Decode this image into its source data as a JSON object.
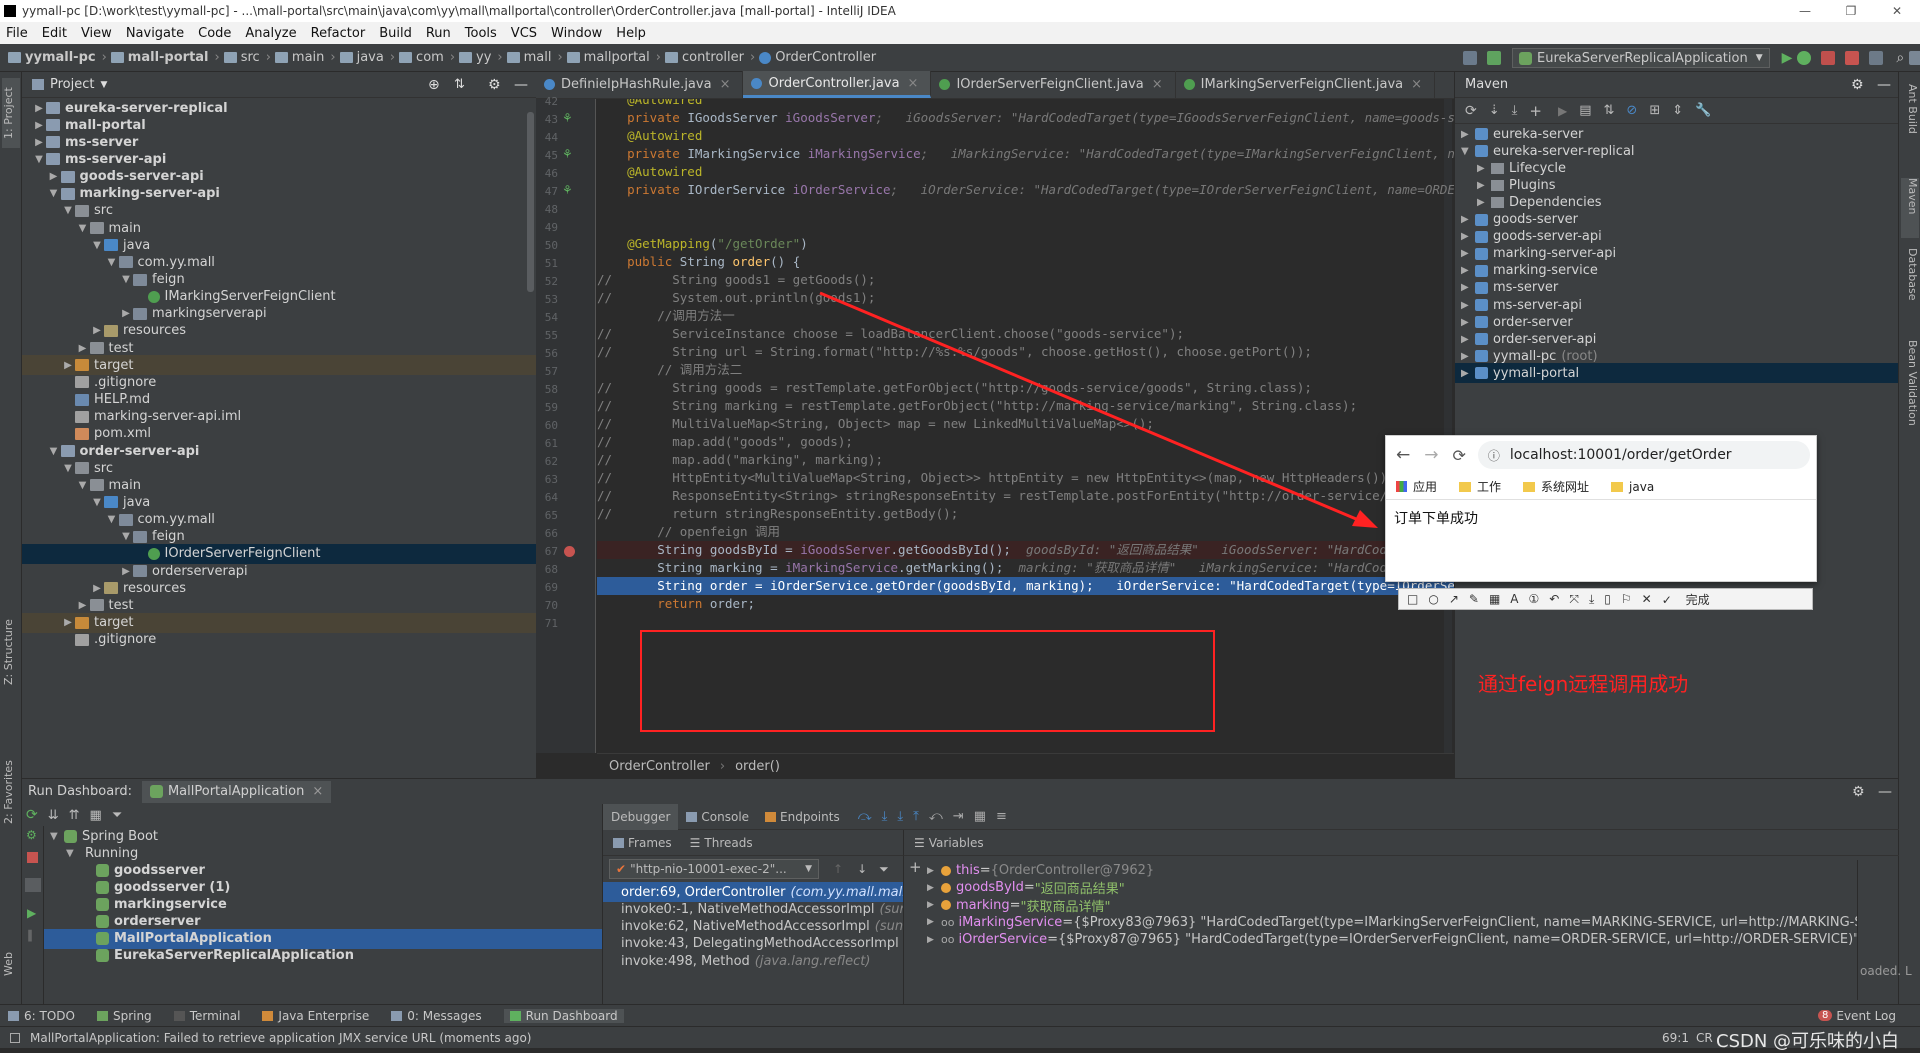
{
  "window": {
    "title": "yymall-pc [D:\\work\\test\\yymall-pc] - ...\\mall-portal\\src\\main\\java\\com\\yy\\mall\\mallportal\\controller\\OrderController.java [mall-portal] - IntelliJ IDEA"
  },
  "menu": [
    "File",
    "Edit",
    "View",
    "Navigate",
    "Code",
    "Analyze",
    "Refactor",
    "Build",
    "Run",
    "Tools",
    "VCS",
    "Window",
    "Help"
  ],
  "nav": {
    "crumbs": [
      "yymall-pc",
      "mall-portal",
      "src",
      "main",
      "java",
      "com",
      "yy",
      "mall",
      "mallportal",
      "controller",
      "OrderController"
    ],
    "run_config": "EurekaServerReplicalApplication"
  },
  "left_strip": {
    "project": "1: Project",
    "structure": "Z: Structure",
    "favorites": "2: Favorites",
    "web": "Web"
  },
  "project": {
    "header": "Project",
    "rows": [
      {
        "label": "eureka-server-replical",
        "depth": 0,
        "arrow": "▶",
        "icon": "mod",
        "bold": true
      },
      {
        "label": "mall-portal",
        "depth": 0,
        "arrow": "▶",
        "icon": "mod",
        "bold": true
      },
      {
        "label": "ms-server",
        "depth": 0,
        "arrow": "▶",
        "icon": "mod",
        "bold": true
      },
      {
        "label": "ms-server-api",
        "depth": 0,
        "arrow": "▼",
        "icon": "mod",
        "bold": true
      },
      {
        "label": "goods-server-api",
        "depth": 1,
        "arrow": "▶",
        "icon": "mod",
        "bold": true
      },
      {
        "label": "marking-server-api",
        "depth": 1,
        "arrow": "▼",
        "icon": "mod",
        "bold": true
      },
      {
        "label": "src",
        "depth": 2,
        "arrow": "▼",
        "icon": "fold"
      },
      {
        "label": "main",
        "depth": 3,
        "arrow": "▼",
        "icon": "fold"
      },
      {
        "label": "java",
        "depth": 4,
        "arrow": "▼",
        "icon": "src"
      },
      {
        "label": "com.yy.mall",
        "depth": 5,
        "arrow": "▼",
        "icon": "pkg"
      },
      {
        "label": "feign",
        "depth": 6,
        "arrow": "▼",
        "icon": "pkg"
      },
      {
        "label": "IMarkingServerFeignClient",
        "depth": 7,
        "arrow": "",
        "icon": "iface"
      },
      {
        "label": "markingserverapi",
        "depth": 6,
        "arrow": "▶",
        "icon": "pkg"
      },
      {
        "label": "resources",
        "depth": 4,
        "arrow": "▶",
        "icon": "res"
      },
      {
        "label": "test",
        "depth": 3,
        "arrow": "▶",
        "icon": "fold"
      },
      {
        "label": "target",
        "depth": 2,
        "arrow": "▶",
        "icon": "excl",
        "hl": true
      },
      {
        "label": ".gitignore",
        "depth": 2,
        "arrow": "",
        "icon": "file"
      },
      {
        "label": "HELP.md",
        "depth": 2,
        "arrow": "",
        "icon": "md"
      },
      {
        "label": "marking-server-api.iml",
        "depth": 2,
        "arrow": "",
        "icon": "file"
      },
      {
        "label": "pom.xml",
        "depth": 2,
        "arrow": "",
        "icon": "xml"
      },
      {
        "label": "order-server-api",
        "depth": 1,
        "arrow": "▼",
        "icon": "mod",
        "bold": true
      },
      {
        "label": "src",
        "depth": 2,
        "arrow": "▼",
        "icon": "fold"
      },
      {
        "label": "main",
        "depth": 3,
        "arrow": "▼",
        "icon": "fold"
      },
      {
        "label": "java",
        "depth": 4,
        "arrow": "▼",
        "icon": "src"
      },
      {
        "label": "com.yy.mall",
        "depth": 5,
        "arrow": "▼",
        "icon": "pkg"
      },
      {
        "label": "feign",
        "depth": 6,
        "arrow": "▼",
        "icon": "pkg"
      },
      {
        "label": "IOrderServerFeignClient",
        "depth": 7,
        "arrow": "",
        "icon": "iface",
        "selected": true
      },
      {
        "label": "orderserverapi",
        "depth": 6,
        "arrow": "▶",
        "icon": "pkg"
      },
      {
        "label": "resources",
        "depth": 4,
        "arrow": "▶",
        "icon": "res"
      },
      {
        "label": "test",
        "depth": 3,
        "arrow": "▶",
        "icon": "fold"
      },
      {
        "label": "target",
        "depth": 2,
        "arrow": "▶",
        "icon": "excl",
        "hl": true
      },
      {
        "label": ".gitignore",
        "depth": 2,
        "arrow": "",
        "icon": "file"
      }
    ]
  },
  "editor": {
    "tabs": [
      {
        "label": "DefinieIpHashRule.java",
        "active": false,
        "color": "#4a88c7"
      },
      {
        "label": "OrderController.java",
        "active": true,
        "color": "#4a88c7"
      },
      {
        "label": "IOrderServerFeignClient.java",
        "active": false,
        "color": "#4f9e50"
      },
      {
        "label": "IMarkingServerFeignClient.java",
        "active": false,
        "color": "#4f9e50"
      }
    ],
    "line_numbers": [
      "42",
      "43",
      "44",
      "45",
      "46",
      "47",
      "48",
      "49",
      "50",
      "51",
      "52",
      "53",
      "54",
      "55",
      "56",
      "57",
      "58",
      "59",
      "60",
      "61",
      "62",
      "63",
      "64",
      "65",
      "66",
      "67",
      "68",
      "69",
      "70",
      "71"
    ],
    "breadcrumb": [
      "OrderController",
      "order()"
    ]
  },
  "code_lines": [
    [
      {
        "t": "    @Autowired",
        "c": "an"
      }
    ],
    [
      {
        "t": "    private ",
        "c": "kw"
      },
      {
        "t": "IGoodsServer ",
        "c": ""
      },
      {
        "t": "iGoodsServer",
        "c": "fld"
      },
      {
        "t": ";   iGoodsServer: \"HardCodedTarget(type=IGoodsServerFeignClient, name=goods-service, url=",
        "c": "hint"
      }
    ],
    [
      {
        "t": "    @Autowired",
        "c": "an"
      }
    ],
    [
      {
        "t": "    private ",
        "c": "kw"
      },
      {
        "t": "IMarkingService ",
        "c": ""
      },
      {
        "t": "iMarkingService",
        "c": "fld"
      },
      {
        "t": ";   iMarkingService: \"HardCodedTarget(type=IMarkingServerFeignClient, name=MARK",
        "c": "hint"
      }
    ],
    [
      {
        "t": "    @Autowired",
        "c": "an"
      }
    ],
    [
      {
        "t": "    private ",
        "c": "kw"
      },
      {
        "t": "IOrderService ",
        "c": ""
      },
      {
        "t": "iOrderService",
        "c": "fld"
      },
      {
        "t": ";   iOrderService: \"HardCodedTarget(type=IOrderServerFeignClient, name=ORDER-SERVI",
        "c": "hint"
      }
    ],
    [
      {
        "t": "",
        "c": ""
      }
    ],
    [
      {
        "t": "",
        "c": ""
      }
    ],
    [
      {
        "t": "    @GetMapping",
        "c": "an"
      },
      {
        "t": "(",
        "c": ""
      },
      {
        "t": "\"/getOrder\"",
        "c": "str"
      },
      {
        "t": ")",
        "c": ""
      }
    ],
    [
      {
        "t": "    public ",
        "c": "kw"
      },
      {
        "t": "String ",
        "c": ""
      },
      {
        "t": "order",
        "c": "fn"
      },
      {
        "t": "() {",
        "c": ""
      }
    ],
    [
      {
        "t": "//        String goods1 = getGoods();",
        "c": "cm"
      }
    ],
    [
      {
        "t": "//        System.out.println(goods1);",
        "c": "cm"
      }
    ],
    [
      {
        "t": "        //调用方法一",
        "c": "cm"
      }
    ],
    [
      {
        "t": "//        ServiceInstance choose = loadBalancerClient.choose(\"goods-service\");",
        "c": "cm"
      }
    ],
    [
      {
        "t": "//        String url = String.format(\"http://%s:%s/goods\", choose.getHost(), choose.getPort());",
        "c": "cm"
      }
    ],
    [
      {
        "t": "        // 调用方法二",
        "c": "cm"
      }
    ],
    [
      {
        "t": "//        String goods = restTemplate.getForObject(\"http://goods-service/goods\", String.class);",
        "c": "cm"
      }
    ],
    [
      {
        "t": "//        String marking = restTemplate.getForObject(\"http://marking-service/marking\", String.class);",
        "c": "cm"
      }
    ],
    [
      {
        "t": "//        MultiValueMap<String, Object> map = new LinkedMultiValueMap<>();",
        "c": "cm"
      }
    ],
    [
      {
        "t": "//        map.add(\"goods\", goods);",
        "c": "cm"
      }
    ],
    [
      {
        "t": "//        map.add(\"marking\", marking);",
        "c": "cm"
      }
    ],
    [
      {
        "t": "//        HttpEntity<MultiValueMap<String, Object>> httpEntity = new HttpEntity<>(map, new HttpHeaders());",
        "c": "cm"
      }
    ],
    [
      {
        "t": "//        ResponseEntity<String> stringResponseEntity = restTemplate.postForEntity(\"http://order-service/order\", httpEnti",
        "c": "cm"
      }
    ],
    [
      {
        "t": "//        return stringResponseEntity.getBody();",
        "c": "cm"
      }
    ],
    [
      {
        "t": "        // openfeign 调用",
        "c": "cm"
      }
    ],
    [
      {
        "t": "        String goodsById = ",
        "c": ""
      },
      {
        "t": "iGoodsServer",
        "c": "fld"
      },
      {
        "t": ".getGoodsById();  ",
        "c": ""
      },
      {
        "t": "goodsById: \"返回商品结果\"   iGoodsServer: \"HardCodedTarget(type=I",
        "c": "hint"
      }
    ],
    [
      {
        "t": "        String marking = ",
        "c": ""
      },
      {
        "t": "iMarkingService",
        "c": "fld"
      },
      {
        "t": ".getMarking();  ",
        "c": ""
      },
      {
        "t": "marking: \"获取商品详情\"   iMarkingService: \"HardCodedTarget(type=I",
        "c": "hint"
      }
    ],
    [
      {
        "t": "        String order = iOrderService.getOrder(goodsById, marking);   iOrderService: \"HardCodedTarget(type=IOrderServerFeig",
        "c": ""
      }
    ],
    [
      {
        "t": "        return ",
        "c": "kw"
      },
      {
        "t": "order;",
        "c": ""
      }
    ],
    [
      {
        "t": "",
        "c": ""
      }
    ]
  ],
  "maven": {
    "header": "Maven",
    "rows": [
      {
        "label": "eureka-server",
        "depth": 0,
        "arrow": "▶",
        "icon": "mi"
      },
      {
        "label": "eureka-server-replical",
        "depth": 0,
        "arrow": "▼",
        "icon": "mi"
      },
      {
        "label": "Lifecycle",
        "depth": 1,
        "arrow": "▶",
        "icon": "mf"
      },
      {
        "label": "Plugins",
        "depth": 1,
        "arrow": "▶",
        "icon": "mf"
      },
      {
        "label": "Dependencies",
        "depth": 1,
        "arrow": "▶",
        "icon": "mf"
      },
      {
        "label": "goods-server",
        "depth": 0,
        "arrow": "▶",
        "icon": "mi"
      },
      {
        "label": "goods-server-api",
        "depth": 0,
        "arrow": "▶",
        "icon": "mi"
      },
      {
        "label": "marking-server-api",
        "depth": 0,
        "arrow": "▶",
        "icon": "mi"
      },
      {
        "label": "marking-service",
        "depth": 0,
        "arrow": "▶",
        "icon": "mi"
      },
      {
        "label": "ms-server",
        "depth": 0,
        "arrow": "▶",
        "icon": "mi"
      },
      {
        "label": "ms-server-api",
        "depth": 0,
        "arrow": "▶",
        "icon": "mi"
      },
      {
        "label": "order-server",
        "depth": 0,
        "arrow": "▶",
        "icon": "mi"
      },
      {
        "label": "order-server-api",
        "depth": 0,
        "arrow": "▶",
        "icon": "mi"
      },
      {
        "label": "yymall-pc",
        "suffix": "(root)",
        "depth": 0,
        "arrow": "▶",
        "icon": "mi"
      },
      {
        "label": "yymall-portal",
        "depth": 0,
        "arrow": "▶",
        "icon": "mi",
        "selected": true
      }
    ]
  },
  "right_strip": {
    "ant": "Ant Build",
    "maven": "Maven",
    "database": "Database",
    "bean": "Bean Validation"
  },
  "browser": {
    "url": "localhost:10001/order/getOrder",
    "bookmarks": [
      "应用",
      "工作",
      "系统网址",
      "java"
    ],
    "content": "订单下单成功"
  },
  "snip_toolbar": {
    "done": "完成"
  },
  "annotation": "通过feign远程调用成功",
  "run_dashboard": {
    "title": "Run Dashboard:",
    "app_tab": "MallPortalApplication",
    "tree": [
      {
        "label": "Spring Boot",
        "depth": 0,
        "arrow": "▼",
        "bold": false
      },
      {
        "label": "Running",
        "depth": 1,
        "arrow": "▼",
        "bold": false
      },
      {
        "label": "goodsserver",
        "depth": 2,
        "arrow": "",
        "bold": true
      },
      {
        "label": "goodsserver (1)",
        "depth": 2,
        "arrow": "",
        "bold": true
      },
      {
        "label": "markingservice",
        "depth": 2,
        "arrow": "",
        "bold": true
      },
      {
        "label": "orderserver",
        "depth": 2,
        "arrow": "",
        "bold": true
      },
      {
        "label": "MallPortalApplication",
        "depth": 2,
        "arrow": "",
        "bold": true,
        "selected": true
      },
      {
        "label": "EurekaServerReplicalApplication",
        "depth": 2,
        "arrow": "",
        "bold": true
      }
    ]
  },
  "debugger": {
    "tabs": [
      "Debugger",
      "Console",
      "Endpoints"
    ],
    "frames_label": "Frames",
    "threads_label": "Threads",
    "variables_label": "Variables",
    "thread_select": "\"http-nio-10001-exec-2\"...",
    "frames": [
      {
        "label": "order:69, OrderController",
        "pkg": "(com.yy.mall.mallport",
        "current": true
      },
      {
        "label": "invoke0:-1, NativeMethodAccessorImpl",
        "pkg": "(sun.refl",
        "current": false
      },
      {
        "label": "invoke:62, NativeMethodAccessorImpl",
        "pkg": "(sun.refle",
        "current": false
      },
      {
        "label": "invoke:43, DelegatingMethodAccessorImpl",
        "pkg": "(sun.",
        "current": false
      },
      {
        "label": "invoke:498, Method",
        "pkg": "(java.lang.reflect)",
        "current": false
      }
    ],
    "variables": [
      {
        "name": "this",
        "eq": " = ",
        "val": "{OrderController@7962}",
        "kind": "gray",
        "oo": false
      },
      {
        "name": "goodsById",
        "eq": " = ",
        "val": "\"返回商品结果\"",
        "kind": "str",
        "oo": false
      },
      {
        "name": "marking",
        "eq": " = ",
        "val": "\"获取商品详情\"",
        "kind": "str",
        "oo": false
      },
      {
        "name": "iMarkingService",
        "eq": " = ",
        "val": "{$Proxy83@7963} \"HardCodedTarget(type=IMarkingServerFeignClient, name=MARKING-SERVICE, url=http://MARKING-SERVICE)\"",
        "kind": "plain",
        "oo": true
      },
      {
        "name": "iOrderService",
        "eq": " = ",
        "val": "{$Proxy87@7965} \"HardCodedTarget(type=IOrderServerFeignClient, name=ORDER-SERVICE, url=http://ORDER-SERVICE)\"",
        "kind": "plain",
        "oo": true
      }
    ],
    "overflow_text": "oaded. L"
  },
  "bottom_tabs": [
    "6: TODO",
    "Spring",
    "Terminal",
    "Java Enterprise",
    "0: Messages",
    "Run Dashboard"
  ],
  "event_log": {
    "count": "8",
    "label": "Event Log"
  },
  "status": {
    "message": "MallPortalApplication: Failed to retrieve application JMX service URL (moments ago)",
    "position": "69:1",
    "encoding": "CR",
    "watermark": "CSDN @可乐味的小白"
  },
  "colors": {
    "accent": "#4a88c7",
    "selection": "#2d5c9a",
    "annotation": "#ff2222"
  }
}
